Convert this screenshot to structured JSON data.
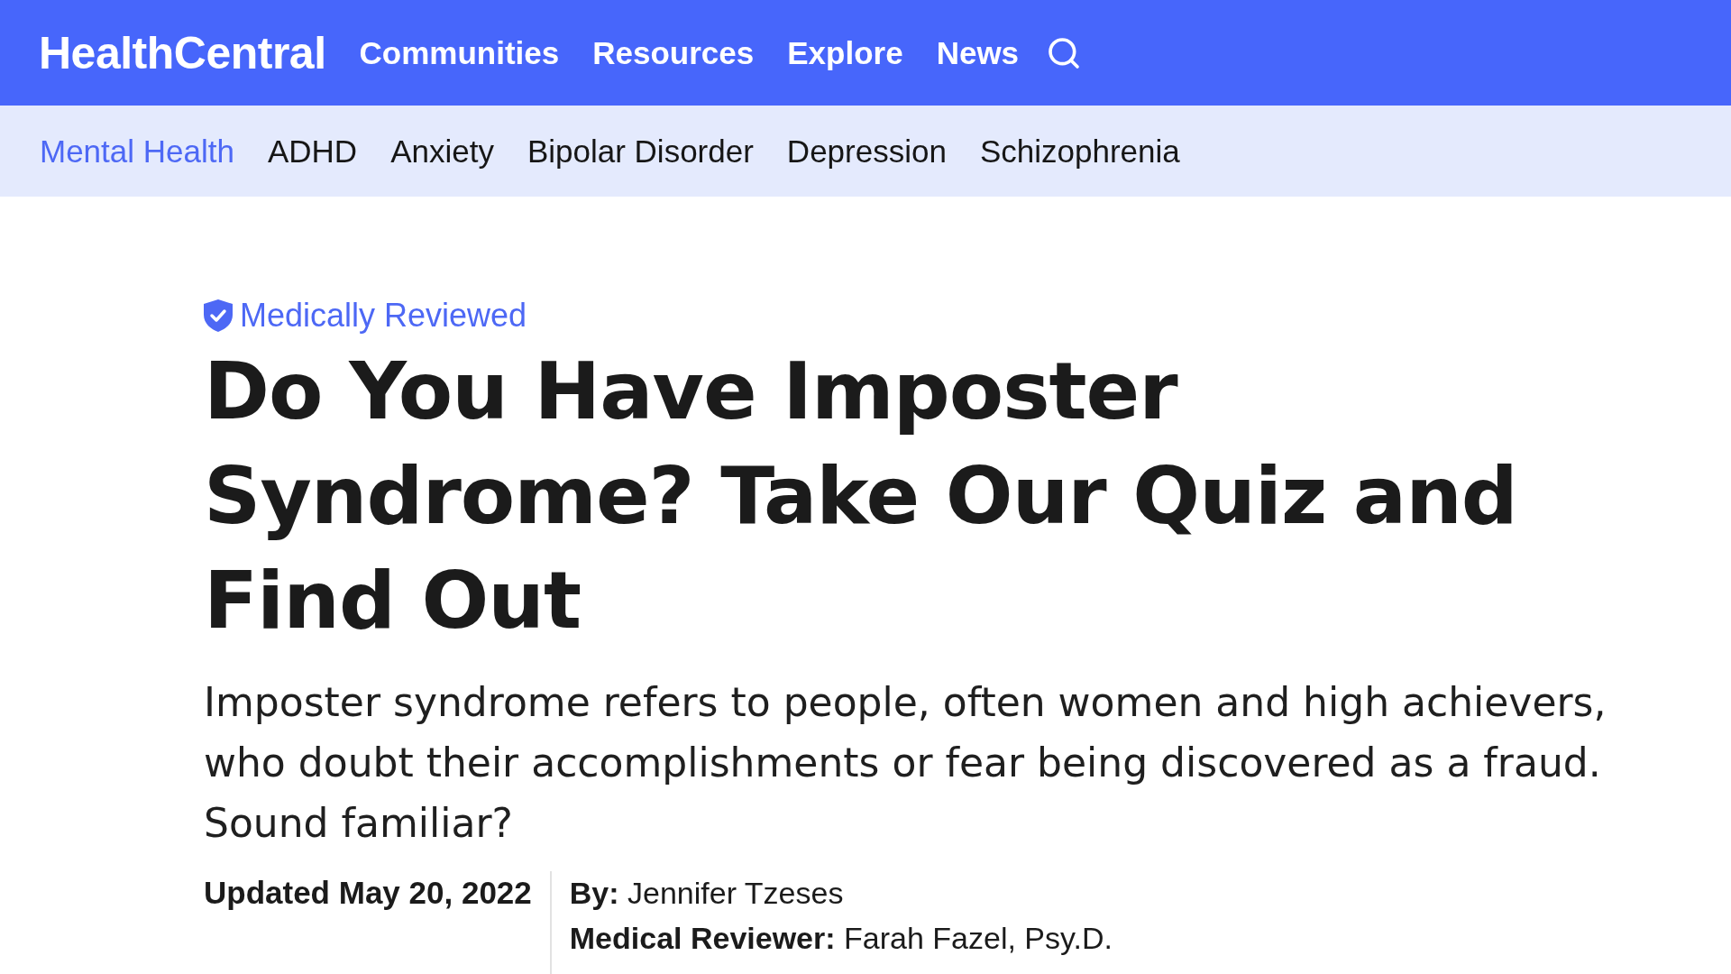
{
  "header": {
    "logo": "HealthCentral",
    "nav": [
      "Communities",
      "Resources",
      "Explore",
      "News"
    ]
  },
  "subnav": [
    {
      "label": "Mental Health",
      "selected": true
    },
    {
      "label": "ADHD",
      "selected": false
    },
    {
      "label": "Anxiety",
      "selected": false
    },
    {
      "label": "Bipolar Disorder",
      "selected": false
    },
    {
      "label": "Depression",
      "selected": false
    },
    {
      "label": "Schizophrenia",
      "selected": false
    }
  ],
  "article": {
    "badge": "Medically Reviewed",
    "title": "Do You Have Imposter Syndrome? Take Our Quiz and Find Out",
    "description": "Imposter syndrome refers to people, often women and high achievers, who doubt their accomplishments or fear being discovered as a fraud. Sound familiar?",
    "updated": "Updated May 20, 2022",
    "credits": [
      "**By:** Jennifer Tzeses",
      "**Medical Reviewer:** Farah Fazel, Psy.D."
    ]
  }
}
